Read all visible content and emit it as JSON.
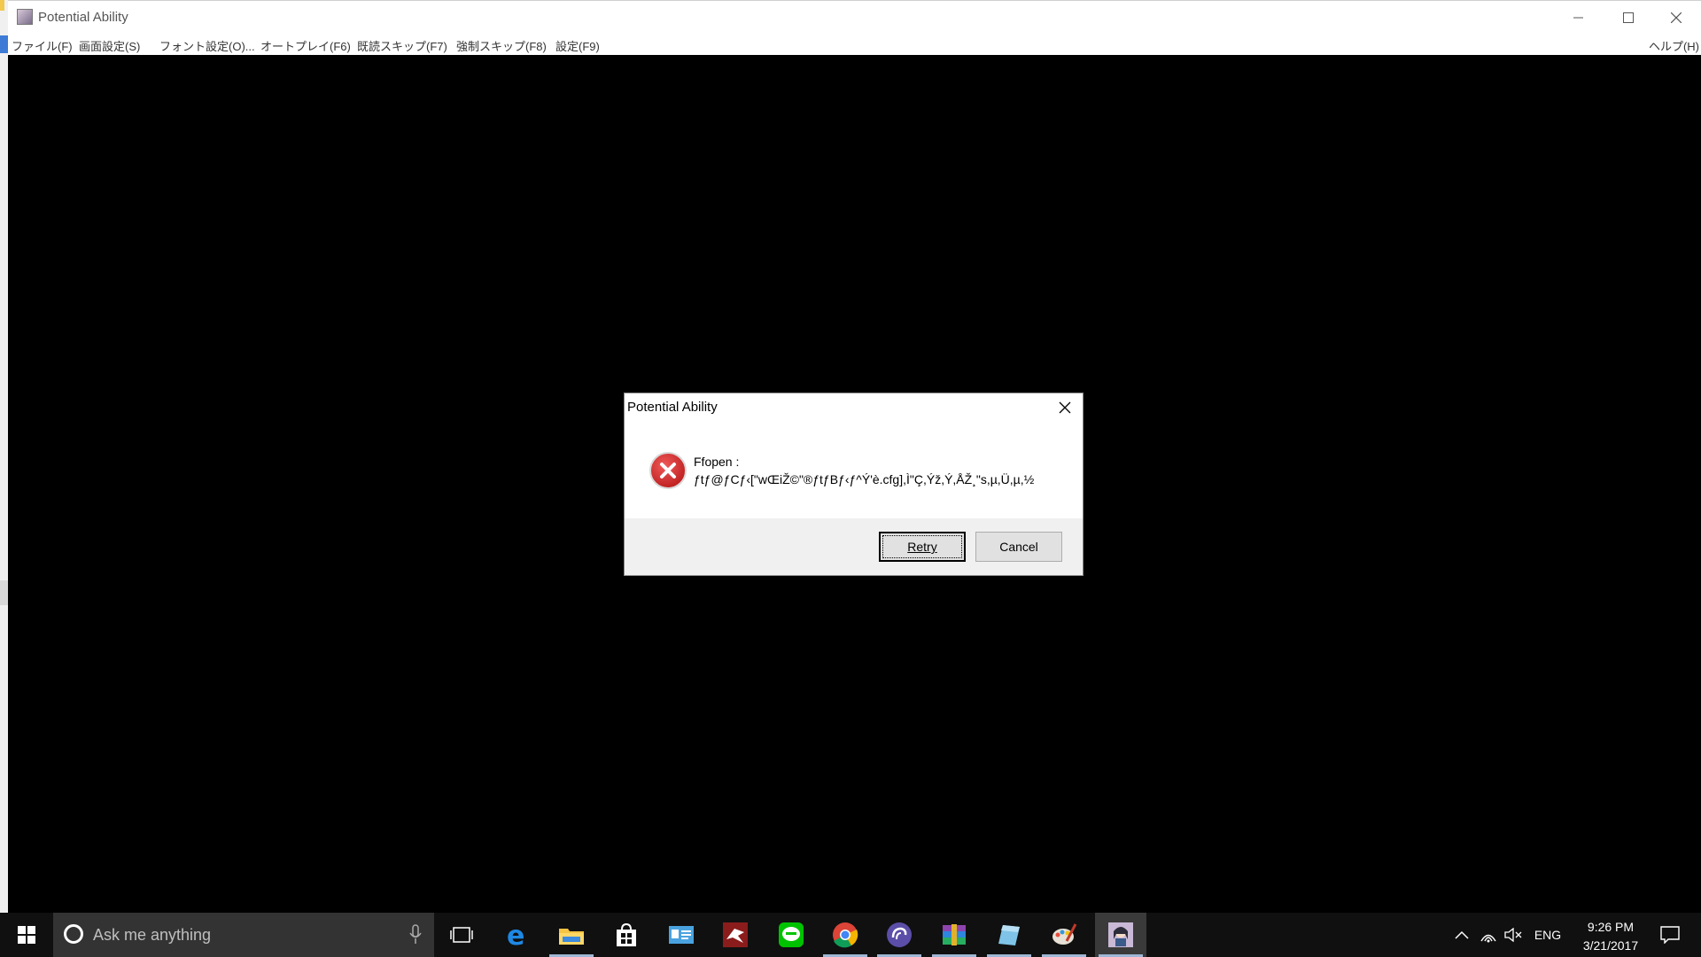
{
  "window": {
    "title": "Potential Ability",
    "menu": [
      "ファイル(F)",
      "画面設定(S)",
      "フォント設定(O)...",
      "オートプレイ(F6)",
      "既読スキップ(F7)",
      "強制スキップ(F8)",
      "設定(F9)"
    ],
    "help_menu": "ヘルプ(H)"
  },
  "dialog": {
    "title": "Potential Ability",
    "message_line1": "Ffopen :",
    "message_line2": "ƒtƒ@ƒCƒ‹[\"wŒiŽ©\"®ƒtƒBƒ‹ƒ^Ý'è.cfg],Ì\"Ç,Ýž,Ý,ÅŽ¸\"s,µ,Ü,µ,½",
    "retry_label": "Retry",
    "cancel_label": "Cancel"
  },
  "taskbar": {
    "search_placeholder": "Ask me anything",
    "icons": [
      "task-view",
      "edge",
      "file-explorer",
      "store",
      "outlook-card",
      "bird-app",
      "line",
      "chrome",
      "torrent",
      "winrar",
      "tablet-app",
      "paint-palette",
      "game-active"
    ],
    "tray": {
      "language": "ENG",
      "time": "9:26 PM",
      "date": "3/21/2017"
    }
  },
  "colors": {
    "dialog_footer": "#f0f0f0",
    "taskbar": "#101010",
    "error_red": "#c81818"
  }
}
